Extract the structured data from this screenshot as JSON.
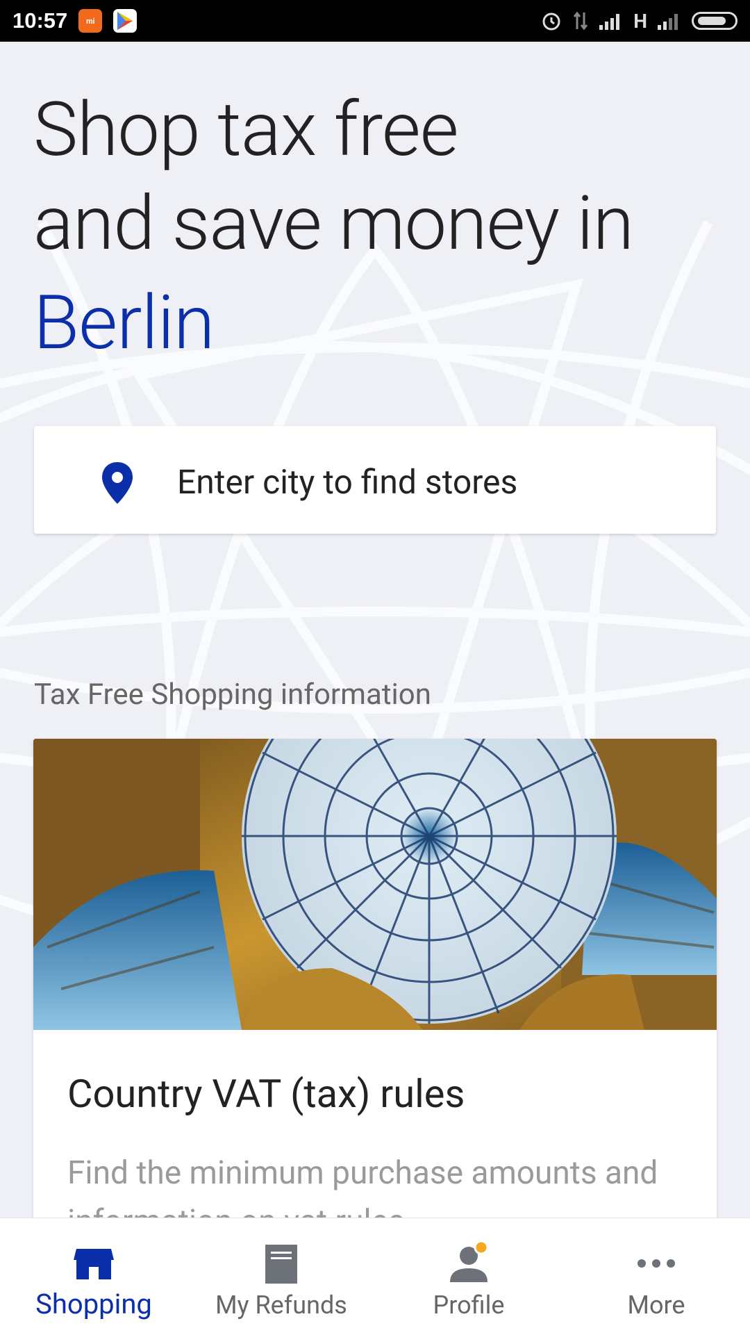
{
  "status_bar": {
    "time": "10:57",
    "network": "H"
  },
  "hero": {
    "line1": "Shop tax free",
    "line2": "and save money in",
    "city": "Berlin"
  },
  "search": {
    "placeholder": "Enter city to find stores",
    "icon": "location-pin-icon"
  },
  "info_section": {
    "title": "Tax Free Shopping information",
    "card": {
      "title": "Country VAT (tax) rules",
      "description": "Find the minimum purchase amounts and information on vat rules"
    }
  },
  "bottom_nav": {
    "items": [
      {
        "label": "Shopping",
        "icon": "shop-icon",
        "active": true
      },
      {
        "label": "My Refunds",
        "icon": "receipt-icon",
        "active": false
      },
      {
        "label": "Profile",
        "icon": "profile-icon",
        "active": false
      },
      {
        "label": "More",
        "icon": "more-dots-icon",
        "active": false
      }
    ]
  },
  "colors": {
    "accent": "#0b2fa8",
    "background": "#eef0f6",
    "notification_dot": "#f5a623"
  }
}
